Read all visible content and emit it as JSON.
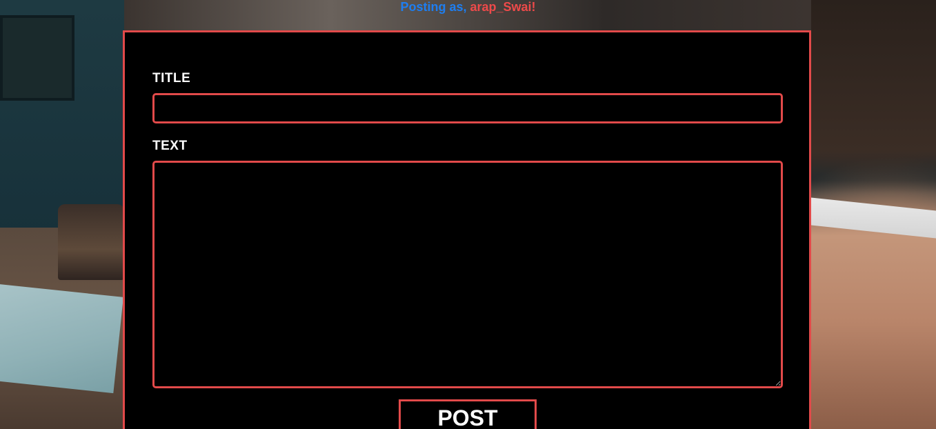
{
  "header": {
    "posting_prefix": "Posting as, ",
    "username": "arap_Swai!"
  },
  "form": {
    "title_label": "TITLE",
    "title_value": "",
    "text_label": "TEXT",
    "text_value": "",
    "post_button_label": "POST"
  },
  "colors": {
    "accent_red": "#e24a4a",
    "prefix_blue": "#1e7ef0",
    "panel_background": "#000000",
    "label_text": "#ffffff"
  }
}
